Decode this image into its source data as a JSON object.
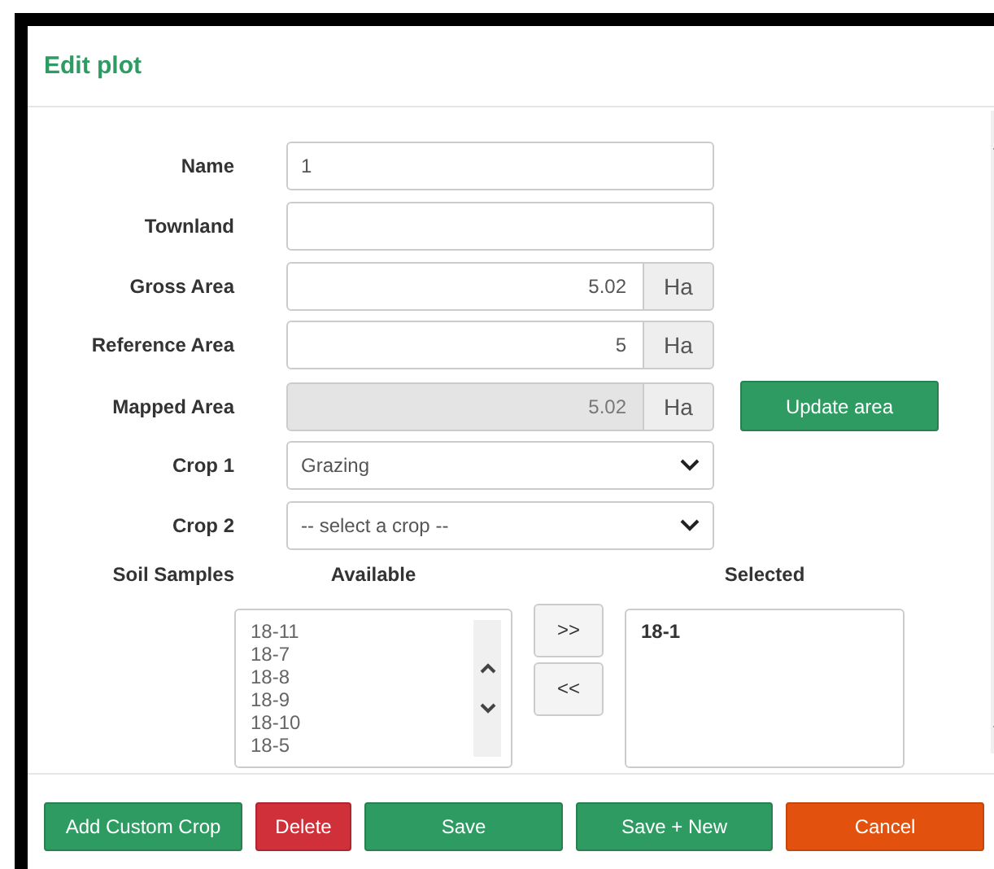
{
  "dialog": {
    "title": "Edit plot"
  },
  "fields": [
    {
      "kind": "text",
      "label": "Name",
      "value": "1",
      "disabled": false
    },
    {
      "kind": "text",
      "label": "Townland",
      "disabled": false
    },
    {
      "kind": "area",
      "label": "Gross Area",
      "value": "5.02",
      "unit": "Ha",
      "disabled": false
    },
    {
      "kind": "area",
      "label": "Reference Area",
      "value": "5",
      "unit": "Ha",
      "disabled": false
    },
    {
      "kind": "area",
      "label": "Mapped Area",
      "value": "5.02",
      "unit": "Ha",
      "disabled": true,
      "action": "Update area"
    },
    {
      "kind": "select",
      "label": "Crop 1",
      "value": "Grazing",
      "disabled": false
    },
    {
      "kind": "select",
      "label": "Crop 2",
      "value": "-- select a crop --",
      "disabled": false
    }
  ],
  "soil_samples": {
    "label": "Soil Samples",
    "available_heading": "Available",
    "selected_heading": "Selected",
    "add_button": ">>",
    "remove_button": "<<",
    "available": [
      "18-11",
      "18-7",
      "18-8",
      "18-9",
      "18-10",
      "18-5"
    ],
    "selected": [
      "18-1"
    ]
  },
  "footer_buttons": [
    {
      "label": "Add Custom Crop",
      "kind": "primary"
    },
    {
      "label": "Delete",
      "kind": "danger"
    },
    {
      "label": "Save",
      "kind": "primary"
    },
    {
      "label": "Save + New",
      "kind": "primary"
    },
    {
      "label": "Cancel",
      "kind": "warning"
    }
  ]
}
